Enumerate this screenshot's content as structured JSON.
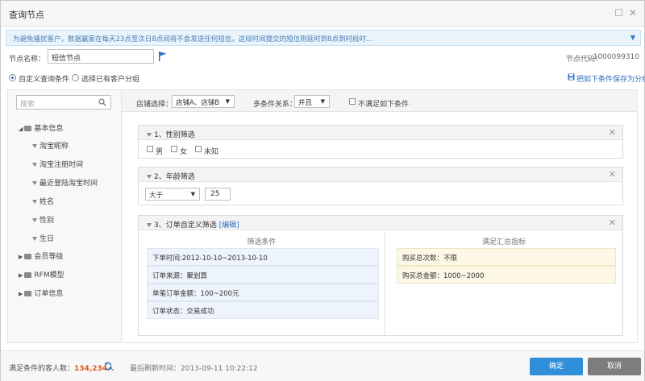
{
  "window": {
    "title": "查询节点"
  },
  "notice": {
    "text": "为避免骚扰客户，数据赢家在每天23点至次日8点间将不会发送任何短信，这段时间提交的短信则延时到8点到时段时..."
  },
  "node": {
    "name_label": "节点名称：",
    "name_value": "短信节点",
    "code_label": "节点代码：",
    "code_value": "1000099310"
  },
  "mode": {
    "option_custom": "自定义查询条件",
    "option_existing": "选择已有客户分组",
    "save_link": "把如下条件保存为分组"
  },
  "search": {
    "placeholder": "搜索"
  },
  "toolbar": {
    "shop_label": "店铺选择：",
    "shop_value": "店铺A、店铺B",
    "relation_label": "多条件关系：",
    "relation_value": "并且",
    "negate_label": "不满足如下条件"
  },
  "tree": {
    "basic": "基本信息",
    "basic_items": [
      "淘宝昵称",
      "淘宝注册时间",
      "最近登陆淘宝时间",
      "姓名",
      "性别",
      "生日"
    ],
    "member": "会员等级",
    "rfm": "RFM模型",
    "order": "订单信息"
  },
  "filter1": {
    "title": "1、性别筛选",
    "options": [
      "男",
      "女",
      "未知"
    ]
  },
  "filter2": {
    "title": "2、年龄筛选",
    "operator": "大于",
    "value": "25"
  },
  "filter3": {
    "title": "3、订单自定义筛选",
    "edit_link": "[编辑]",
    "left_header": "筛选条件",
    "right_header": "满足汇总指标",
    "conditions": [
      "下单时间:2012-10-10~2013-10-10",
      "订单来源：聚划算",
      "单笔订单金额：100~200元",
      "订单状态：交易成功"
    ],
    "metrics": [
      "购买总次数：不限",
      "购买总金额：1000~2000"
    ]
  },
  "footer": {
    "count_label": "满足条件的客人数：",
    "count_value": "134,234",
    "count_unit": "人",
    "refresh_label": "最后刷新时间：",
    "refresh_value": "2013-09-11 10:22:12",
    "confirm": "确定",
    "cancel": "取消"
  },
  "colors": {
    "accent": "#2a6fc0",
    "count": "#e05a1c",
    "confirm_bg": "#2f8fd8",
    "cancel_bg": "#7d7d7d"
  }
}
